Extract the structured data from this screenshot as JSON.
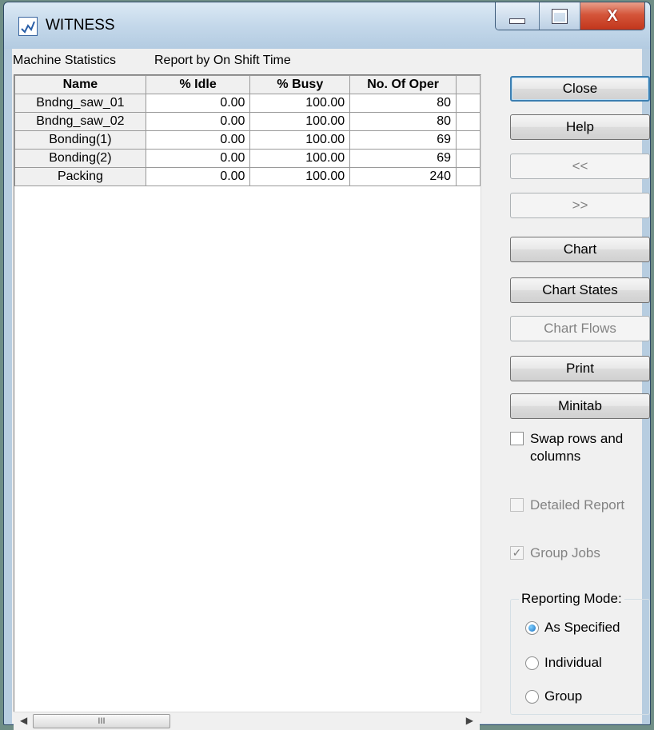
{
  "window": {
    "title": "WITNESS",
    "icon": "witness-app-icon"
  },
  "menu": {
    "item1": "Machine Statistics",
    "item2": "Report by On Shift Time"
  },
  "table": {
    "headers": [
      "Name",
      "% Idle",
      "% Busy",
      "No. Of Oper"
    ],
    "rows": [
      {
        "name": "Bndng_saw_01",
        "idle": "0.00",
        "busy": "100.00",
        "oper": "80"
      },
      {
        "name": "Bndng_saw_02",
        "idle": "0.00",
        "busy": "100.00",
        "oper": "80"
      },
      {
        "name": "Bonding(1)",
        "idle": "0.00",
        "busy": "100.00",
        "oper": "69"
      },
      {
        "name": "Bonding(2)",
        "idle": "0.00",
        "busy": "100.00",
        "oper": "69"
      },
      {
        "name": "Packing",
        "idle": "0.00",
        "busy": "100.00",
        "oper": "240"
      }
    ]
  },
  "buttons": {
    "close": "Close",
    "help": "Help",
    "prev": "<<",
    "next": ">>",
    "chart": "Chart",
    "chart_states": "Chart States",
    "chart_flows": "Chart Flows",
    "print": "Print",
    "minitab": "Minitab"
  },
  "options": {
    "swap": {
      "label": "Swap rows and columns",
      "checked": false
    },
    "detailed": {
      "label": "Detailed Report",
      "checked": false,
      "enabled": false
    },
    "group_jobs": {
      "label": "Group Jobs",
      "checked": true,
      "enabled": false
    }
  },
  "reporting_mode": {
    "title": "Reporting Mode:",
    "options": [
      "As Specified",
      "Individual",
      "Group"
    ],
    "selected": "As Specified"
  },
  "scrollbar": {
    "thumb_glyph": "III"
  }
}
